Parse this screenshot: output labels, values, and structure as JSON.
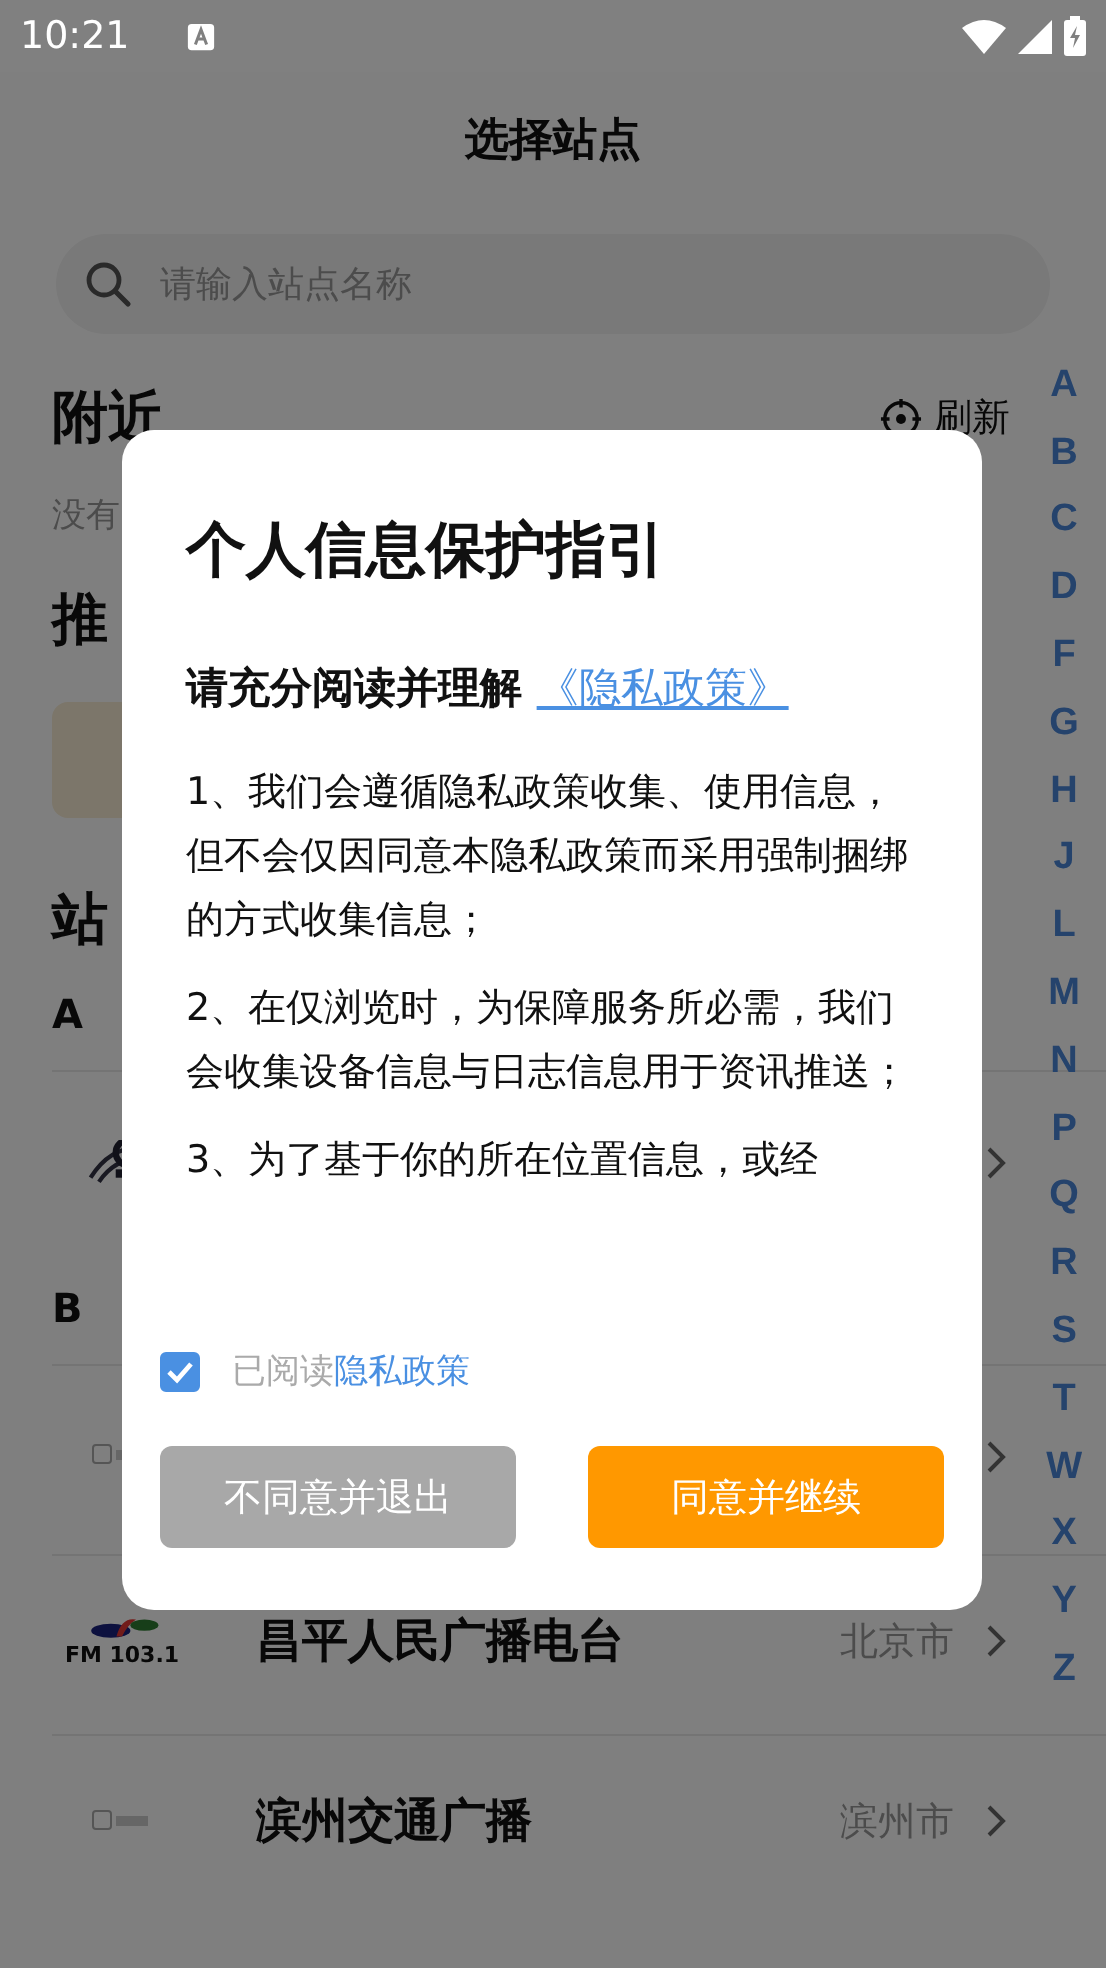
{
  "status_bar": {
    "time": "10:21"
  },
  "header": {
    "title": "选择站点"
  },
  "search": {
    "placeholder": "请输入站点名称"
  },
  "nearby": {
    "title": "附近",
    "refresh": "刷新",
    "empty_text": "没有"
  },
  "recommended": {
    "title": "推"
  },
  "stations": {
    "title": "站",
    "sections": [
      {
        "letter": "A",
        "rows": [
          {
            "kind": "emblem"
          }
        ]
      },
      {
        "letter": "B",
        "rows": [
          {
            "kind": "placeholder"
          },
          {
            "kind": "fm",
            "logo_text": "FM 103.1",
            "name": "昌平人民广播电台",
            "city": "北京市"
          },
          {
            "kind": "placeholder",
            "name": "滨州交通广播",
            "city": "滨州市"
          }
        ]
      }
    ]
  },
  "index": [
    "A",
    "B",
    "C",
    "D",
    "F",
    "G",
    "H",
    "J",
    "L",
    "M",
    "N",
    "P",
    "Q",
    "R",
    "S",
    "T",
    "W",
    "X",
    "Y",
    "Z"
  ],
  "dialog": {
    "title": "个人信息保护指引",
    "lead": "请充分阅读并理解",
    "lead_link": "《隐私政策》",
    "paragraphs": [
      "1、我们会遵循隐私政策收集、使用信息，但不会仅因同意本隐私政策而采用强制捆绑的方式收集信息；",
      "2、在仅浏览时，为保障服务所必需，我们会收集设备信息与日志信息用于资讯推送；",
      "3、为了基于你的所在位置信息，或经"
    ],
    "consent": {
      "checked": true,
      "text": "已阅读",
      "link": "隐私政策"
    },
    "decline": "不同意并退出",
    "accept": "同意并继续"
  }
}
